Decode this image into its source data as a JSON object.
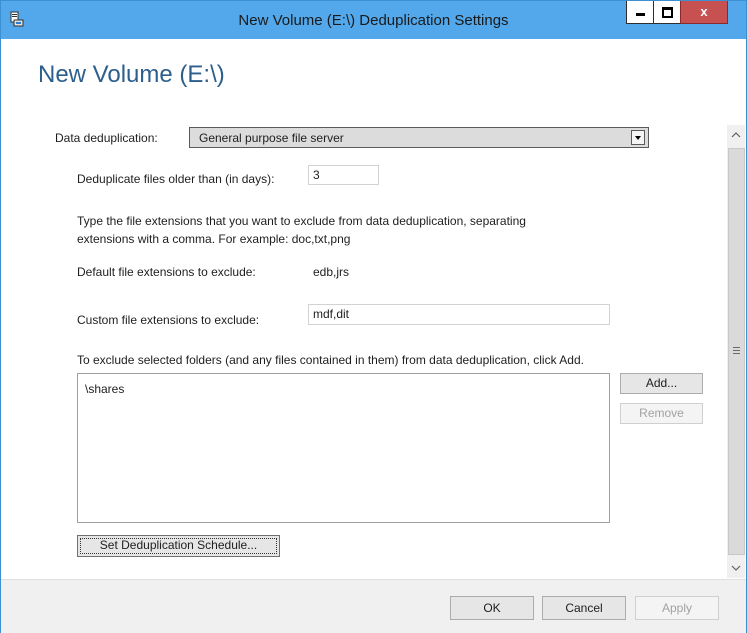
{
  "window": {
    "title": "New Volume (E:\\) Deduplication Settings",
    "close_glyph": "x"
  },
  "page": {
    "heading": "New Volume (E:\\)"
  },
  "dedup": {
    "label": "Data deduplication:",
    "selected": "General purpose file server"
  },
  "days": {
    "label": "Deduplicate files older than (in days):",
    "value": "3"
  },
  "instructions": {
    "line1": "Type the file extensions that you want to exclude from data deduplication, separating",
    "line2": "extensions with a comma. For example: doc,txt,png"
  },
  "default_ext": {
    "label": "Default file extensions to exclude:",
    "value": "edb,jrs"
  },
  "custom_ext": {
    "label": "Custom file extensions to exclude:",
    "value": "mdf,dit"
  },
  "folders": {
    "instruction": "To exclude selected folders (and any files contained in them) from data deduplication, click Add.",
    "items": [
      "\\shares"
    ],
    "add_label": "Add...",
    "remove_label": "Remove"
  },
  "schedule_label": "Set Deduplication Schedule...",
  "buttons": {
    "ok": "OK",
    "cancel": "Cancel",
    "apply": "Apply"
  },
  "icons": {
    "app": "server-settings-icon",
    "minimize": "minimize-icon",
    "maximize": "maximize-icon",
    "close": "close-icon",
    "dropdown": "chevron-down-icon",
    "scroll_up": "scroll-up-icon",
    "scroll_down": "scroll-down-icon",
    "grip": "scroll-grip-icon"
  },
  "colors": {
    "titlebar": "#52a8ea",
    "heading": "#2c5f8c",
    "close_button": "#c75050"
  }
}
